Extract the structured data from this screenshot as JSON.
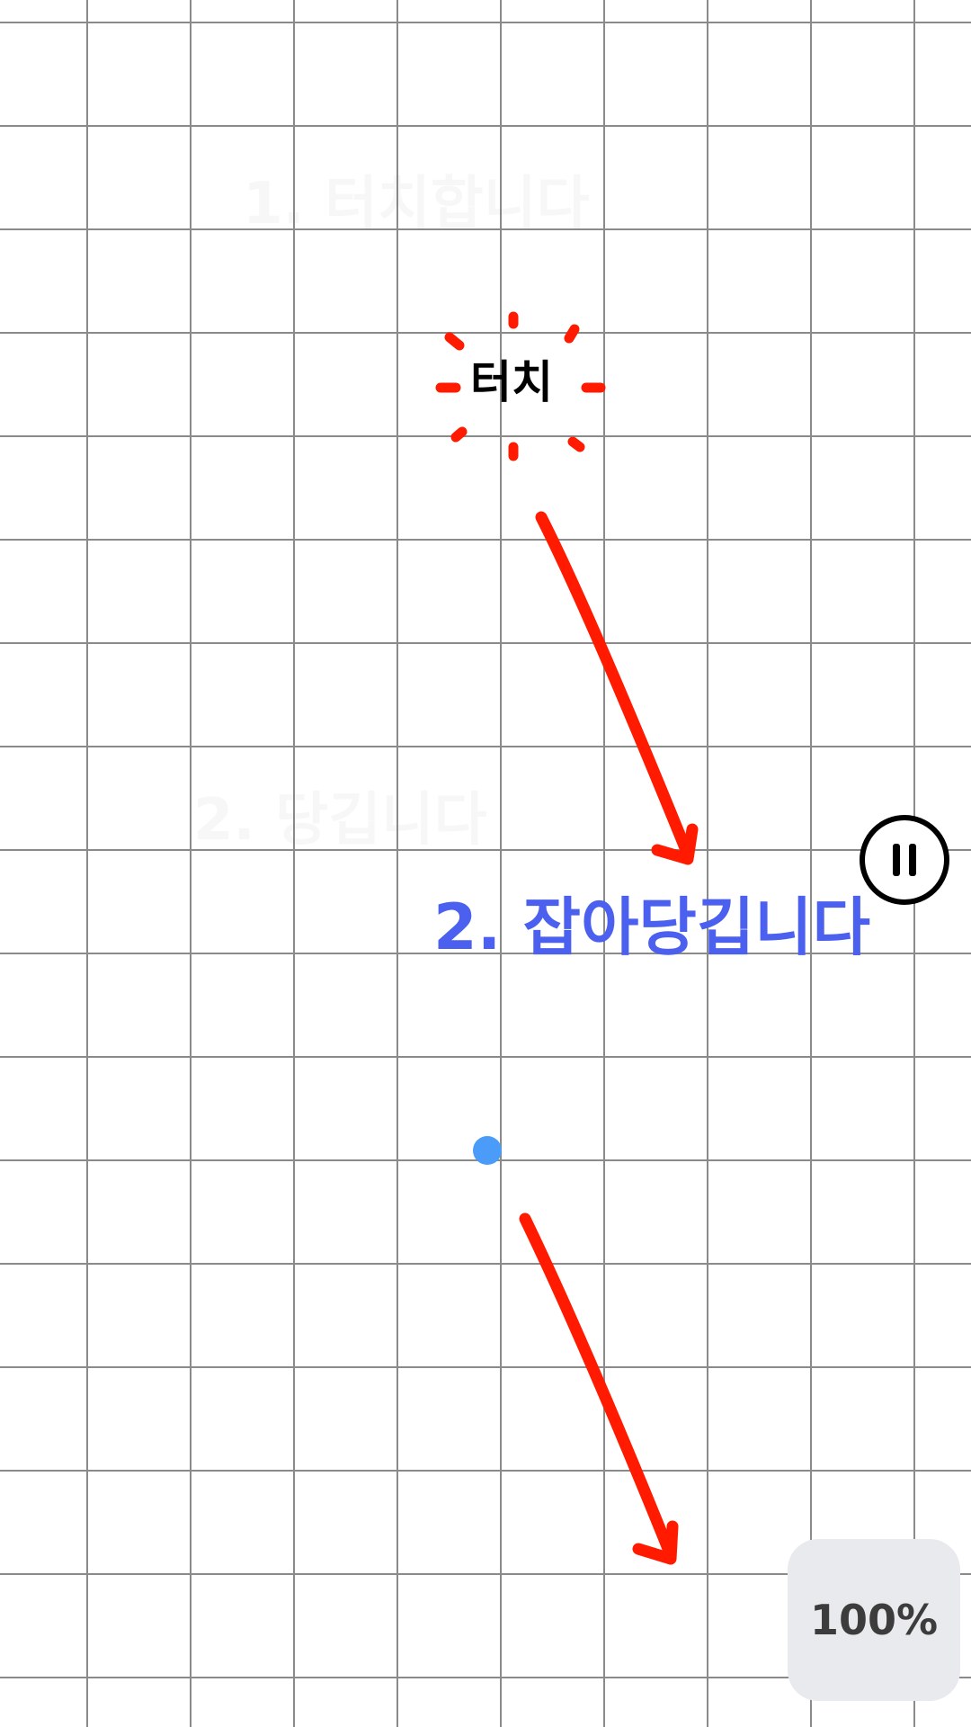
{
  "stage": {
    "grid_color": "#8a8a8a",
    "background_color": "#ffffff"
  },
  "annotations": {
    "touch_label": "터치",
    "instruction": "2. 잡아당깁니다",
    "instruction_color": "#4c60f0",
    "accent_color": "#ff1a00"
  },
  "faint_background_text": {
    "top": "1. 터치합니다",
    "middle": "2. 당깁니다"
  },
  "controls": {
    "pause_icon": "pause-icon",
    "zoom_level": "100%"
  },
  "player": {
    "color": "#4a9cf8"
  }
}
